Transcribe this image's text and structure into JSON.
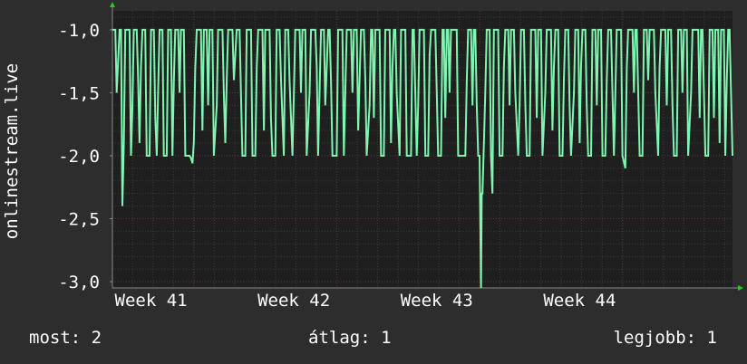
{
  "colors": {
    "background": "#2d2d2d",
    "plot_background": "#1f1f1f",
    "line": "#7ff5b0",
    "grid_minor": "#3a3a3a",
    "grid_major": "#5a3434",
    "axis": "#888888",
    "arrow": "#22cc22",
    "text": "#ffffff"
  },
  "footer": {
    "now": "most: 2",
    "avg": "átlag: 1",
    "best": "legjobb: 1"
  },
  "chart_data": {
    "type": "line",
    "ylabel": "onlinestream.live",
    "y_tick_labels": [
      "-1,0",
      "-1,5",
      "-2,0",
      "-2,5",
      "-3,0"
    ],
    "y_ticks": [
      -1.0,
      -1.5,
      -2.0,
      -2.5,
      -3.0
    ],
    "ylim": [
      -3.05,
      -0.85
    ],
    "x_tick_labels": [
      "Week 41",
      "Week 42",
      "Week 43",
      "Week 44"
    ],
    "x_ticks": [
      40.7,
      41.7,
      42.7,
      43.7
    ],
    "xlim": [
      40.43,
      44.77
    ],
    "grid": true,
    "series": [
      {
        "values": [
          [
            40.43,
            -1.0
          ],
          [
            40.45,
            -1.0
          ],
          [
            40.46,
            -1.5
          ],
          [
            40.48,
            -1.0
          ],
          [
            40.49,
            -1.0
          ],
          [
            40.5,
            -2.4
          ],
          [
            40.51,
            -1.9
          ],
          [
            40.52,
            -1.0
          ],
          [
            40.55,
            -1.0
          ],
          [
            40.56,
            -2.0
          ],
          [
            40.57,
            -1.6
          ],
          [
            40.58,
            -1.0
          ],
          [
            40.6,
            -1.0
          ],
          [
            40.61,
            -1.4
          ],
          [
            40.62,
            -1.9
          ],
          [
            40.63,
            -1.3
          ],
          [
            40.64,
            -1.0
          ],
          [
            40.66,
            -1.0
          ],
          [
            40.67,
            -2.0
          ],
          [
            40.69,
            -2.0
          ],
          [
            40.7,
            -1.0
          ],
          [
            40.72,
            -1.0
          ],
          [
            40.73,
            -1.7
          ],
          [
            40.74,
            -2.0
          ],
          [
            40.75,
            -1.5
          ],
          [
            40.76,
            -1.0
          ],
          [
            40.78,
            -1.0
          ],
          [
            40.79,
            -2.0
          ],
          [
            40.81,
            -2.0
          ],
          [
            40.82,
            -1.0
          ],
          [
            40.84,
            -1.0
          ],
          [
            40.85,
            -2.0
          ],
          [
            40.86,
            -1.4
          ],
          [
            40.87,
            -1.0
          ],
          [
            40.89,
            -1.0
          ],
          [
            40.9,
            -1.5
          ],
          [
            40.91,
            -1.0
          ],
          [
            40.93,
            -1.0
          ],
          [
            40.94,
            -2.0
          ],
          [
            40.97,
            -2.0
          ],
          [
            40.98,
            -2.02
          ],
          [
            40.99,
            -2.06
          ],
          [
            41.0,
            -1.9
          ],
          [
            41.01,
            -1.3
          ],
          [
            41.02,
            -1.0
          ],
          [
            41.05,
            -1.0
          ],
          [
            41.06,
            -1.8
          ],
          [
            41.07,
            -1.0
          ],
          [
            41.09,
            -1.0
          ],
          [
            41.1,
            -1.6
          ],
          [
            41.11,
            -1.0
          ],
          [
            41.13,
            -1.0
          ],
          [
            41.14,
            -2.0
          ],
          [
            41.16,
            -1.6
          ],
          [
            41.17,
            -1.0
          ],
          [
            41.2,
            -1.0
          ],
          [
            41.21,
            -1.5
          ],
          [
            41.22,
            -1.9
          ],
          [
            41.23,
            -1.4
          ],
          [
            41.24,
            -1.0
          ],
          [
            41.27,
            -1.0
          ],
          [
            41.28,
            -1.4
          ],
          [
            41.3,
            -1.0
          ],
          [
            41.32,
            -1.0
          ],
          [
            41.33,
            -1.5
          ],
          [
            41.34,
            -2.0
          ],
          [
            41.36,
            -2.0
          ],
          [
            41.37,
            -1.0
          ],
          [
            41.4,
            -1.0
          ],
          [
            41.41,
            -2.0
          ],
          [
            41.43,
            -2.0
          ],
          [
            41.44,
            -1.3
          ],
          [
            41.45,
            -1.0
          ],
          [
            41.48,
            -1.0
          ],
          [
            41.49,
            -1.8
          ],
          [
            41.5,
            -1.0
          ],
          [
            41.53,
            -1.0
          ],
          [
            41.54,
            -1.7
          ],
          [
            41.55,
            -2.0
          ],
          [
            41.57,
            -2.0
          ],
          [
            41.58,
            -1.0
          ],
          [
            41.6,
            -1.0
          ],
          [
            41.61,
            -1.4
          ],
          [
            41.63,
            -2.0
          ],
          [
            41.64,
            -1.0
          ],
          [
            41.66,
            -1.0
          ],
          [
            41.67,
            -1.4
          ],
          [
            41.69,
            -2.0
          ],
          [
            41.7,
            -1.5
          ],
          [
            41.71,
            -1.0
          ],
          [
            41.74,
            -1.0
          ],
          [
            41.75,
            -1.5
          ],
          [
            41.76,
            -1.0
          ],
          [
            41.78,
            -1.0
          ],
          [
            41.79,
            -2.0
          ],
          [
            41.81,
            -1.5
          ],
          [
            41.82,
            -1.0
          ],
          [
            41.85,
            -1.0
          ],
          [
            41.86,
            -1.3
          ],
          [
            41.87,
            -2.0
          ],
          [
            41.88,
            -1.5
          ],
          [
            41.89,
            -1.0
          ],
          [
            41.91,
            -1.0
          ],
          [
            41.92,
            -1.6
          ],
          [
            41.94,
            -1.0
          ],
          [
            41.95,
            -1.0
          ],
          [
            41.96,
            -1.4
          ],
          [
            41.97,
            -2.0
          ],
          [
            42.0,
            -2.0
          ],
          [
            42.01,
            -1.0
          ],
          [
            42.04,
            -1.0
          ],
          [
            42.05,
            -2.0
          ],
          [
            42.06,
            -1.5
          ],
          [
            42.07,
            -1.0
          ],
          [
            42.1,
            -1.0
          ],
          [
            42.11,
            -1.5
          ],
          [
            42.12,
            -1.0
          ],
          [
            42.14,
            -1.0
          ],
          [
            42.15,
            -1.8
          ],
          [
            42.17,
            -1.0
          ],
          [
            42.19,
            -1.0
          ],
          [
            42.2,
            -1.4
          ],
          [
            42.21,
            -2.0
          ],
          [
            42.23,
            -1.6
          ],
          [
            42.24,
            -1.0
          ],
          [
            42.25,
            -1.0
          ],
          [
            42.26,
            -1.7
          ],
          [
            42.27,
            -1.0
          ],
          [
            42.3,
            -1.0
          ],
          [
            42.31,
            -2.0
          ],
          [
            42.33,
            -2.0
          ],
          [
            42.34,
            -1.0
          ],
          [
            42.37,
            -1.0
          ],
          [
            42.38,
            -1.9
          ],
          [
            42.39,
            -1.3
          ],
          [
            42.4,
            -1.0
          ],
          [
            42.41,
            -1.0
          ],
          [
            42.42,
            -1.5
          ],
          [
            42.44,
            -2.0
          ],
          [
            42.45,
            -1.0
          ],
          [
            42.48,
            -1.0
          ],
          [
            42.49,
            -2.0
          ],
          [
            42.52,
            -2.0
          ],
          [
            42.53,
            -1.0
          ],
          [
            42.54,
            -1.0
          ],
          [
            42.55,
            -1.5
          ],
          [
            42.56,
            -2.0
          ],
          [
            42.57,
            -1.6
          ],
          [
            42.58,
            -1.0
          ],
          [
            42.61,
            -1.0
          ],
          [
            42.62,
            -2.0
          ],
          [
            42.64,
            -2.0
          ],
          [
            42.65,
            -1.2
          ],
          [
            42.66,
            -1.0
          ],
          [
            42.69,
            -1.0
          ],
          [
            42.7,
            -1.5
          ],
          [
            42.71,
            -2.0
          ],
          [
            42.73,
            -2.0
          ],
          [
            42.74,
            -1.0
          ],
          [
            42.75,
            -1.0
          ],
          [
            42.76,
            -1.7
          ],
          [
            42.77,
            -1.0
          ],
          [
            42.78,
            -1.0
          ],
          [
            42.79,
            -1.5
          ],
          [
            42.8,
            -1.0
          ],
          [
            42.84,
            -1.0
          ],
          [
            42.85,
            -2.0
          ],
          [
            42.9,
            -2.0
          ],
          [
            42.91,
            -1.4
          ],
          [
            42.92,
            -1.0
          ],
          [
            42.94,
            -1.0
          ],
          [
            42.95,
            -1.6
          ],
          [
            42.96,
            -1.0
          ],
          [
            42.97,
            -1.0
          ],
          [
            42.98,
            -1.6
          ],
          [
            42.99,
            -2.0
          ],
          [
            43.0,
            -2.0
          ],
          [
            43.01,
            -3.05
          ],
          [
            43.015,
            -2.3
          ],
          [
            43.02,
            -2.3
          ],
          [
            43.03,
            -1.9
          ],
          [
            43.04,
            -1.5
          ],
          [
            43.05,
            -1.0
          ],
          [
            43.07,
            -1.0
          ],
          [
            43.08,
            -2.0
          ],
          [
            43.09,
            -2.3
          ],
          [
            43.1,
            -1.0
          ],
          [
            43.13,
            -1.0
          ],
          [
            43.14,
            -2.0
          ],
          [
            43.16,
            -2.0
          ],
          [
            43.17,
            -1.3
          ],
          [
            43.18,
            -1.0
          ],
          [
            43.2,
            -1.0
          ],
          [
            43.21,
            -1.6
          ],
          [
            43.22,
            -1.0
          ],
          [
            43.24,
            -1.0
          ],
          [
            43.25,
            -1.5
          ],
          [
            43.27,
            -2.0
          ],
          [
            43.28,
            -1.6
          ],
          [
            43.29,
            -1.0
          ],
          [
            43.31,
            -1.0
          ],
          [
            43.32,
            -1.6
          ],
          [
            43.33,
            -2.0
          ],
          [
            43.35,
            -2.0
          ],
          [
            43.36,
            -1.0
          ],
          [
            43.39,
            -1.0
          ],
          [
            43.4,
            -1.7
          ],
          [
            43.41,
            -1.0
          ],
          [
            43.43,
            -1.0
          ],
          [
            43.44,
            -2.0
          ],
          [
            43.46,
            -1.5
          ],
          [
            43.47,
            -1.0
          ],
          [
            43.5,
            -1.0
          ],
          [
            43.51,
            -1.8
          ],
          [
            43.52,
            -1.3
          ],
          [
            43.53,
            -1.0
          ],
          [
            43.55,
            -1.0
          ],
          [
            43.56,
            -2.0
          ],
          [
            43.58,
            -2.0
          ],
          [
            43.59,
            -1.4
          ],
          [
            43.6,
            -1.0
          ],
          [
            43.62,
            -1.0
          ],
          [
            43.63,
            -1.6
          ],
          [
            43.64,
            -2.0
          ],
          [
            43.66,
            -1.5
          ],
          [
            43.67,
            -1.0
          ],
          [
            43.69,
            -1.0
          ],
          [
            43.7,
            -1.9
          ],
          [
            43.71,
            -1.3
          ],
          [
            43.72,
            -1.0
          ],
          [
            43.74,
            -1.0
          ],
          [
            43.75,
            -1.6
          ],
          [
            43.76,
            -2.0
          ],
          [
            43.78,
            -2.0
          ],
          [
            43.79,
            -1.0
          ],
          [
            43.81,
            -1.0
          ],
          [
            43.82,
            -1.6
          ],
          [
            43.83,
            -1.0
          ],
          [
            43.85,
            -1.0
          ],
          [
            43.86,
            -2.0
          ],
          [
            43.88,
            -2.0
          ],
          [
            43.89,
            -1.4
          ],
          [
            43.9,
            -1.0
          ],
          [
            43.92,
            -1.0
          ],
          [
            43.93,
            -1.5
          ],
          [
            43.94,
            -2.0
          ],
          [
            43.95,
            -1.5
          ],
          [
            43.96,
            -1.0
          ],
          [
            43.99,
            -1.0
          ],
          [
            44.0,
            -2.0
          ],
          [
            44.02,
            -2.1
          ],
          [
            44.03,
            -1.3
          ],
          [
            44.04,
            -1.0
          ],
          [
            44.07,
            -1.0
          ],
          [
            44.08,
            -1.5
          ],
          [
            44.09,
            -1.0
          ],
          [
            44.1,
            -1.0
          ],
          [
            44.11,
            -1.5
          ],
          [
            44.12,
            -2.0
          ],
          [
            44.14,
            -2.0
          ],
          [
            44.15,
            -1.0
          ],
          [
            44.17,
            -1.0
          ],
          [
            44.18,
            -1.4
          ],
          [
            44.19,
            -1.0
          ],
          [
            44.22,
            -1.0
          ],
          [
            44.23,
            -1.5
          ],
          [
            44.25,
            -2.0
          ],
          [
            44.26,
            -1.3
          ],
          [
            44.27,
            -1.0
          ],
          [
            44.3,
            -1.0
          ],
          [
            44.31,
            -1.6
          ],
          [
            44.32,
            -1.0
          ],
          [
            44.34,
            -1.0
          ],
          [
            44.35,
            -1.6
          ],
          [
            44.36,
            -2.0
          ],
          [
            44.38,
            -2.0
          ],
          [
            44.39,
            -1.0
          ],
          [
            44.41,
            -1.0
          ],
          [
            44.42,
            -1.5
          ],
          [
            44.43,
            -1.0
          ],
          [
            44.45,
            -1.0
          ],
          [
            44.46,
            -2.0
          ],
          [
            44.48,
            -1.5
          ],
          [
            44.49,
            -1.0
          ],
          [
            44.53,
            -1.0
          ],
          [
            44.54,
            -1.7
          ],
          [
            44.55,
            -1.0
          ],
          [
            44.56,
            -1.0
          ],
          [
            44.57,
            -1.5
          ],
          [
            44.58,
            -2.0
          ],
          [
            44.6,
            -2.0
          ],
          [
            44.61,
            -1.0
          ],
          [
            44.63,
            -1.0
          ],
          [
            44.64,
            -1.7
          ],
          [
            44.65,
            -1.0
          ],
          [
            44.67,
            -1.0
          ],
          [
            44.68,
            -1.9
          ],
          [
            44.69,
            -1.0
          ],
          [
            44.71,
            -1.0
          ],
          [
            44.72,
            -2.0
          ],
          [
            44.73,
            -1.4
          ],
          [
            44.74,
            -1.0
          ],
          [
            44.75,
            -1.0
          ],
          [
            44.76,
            -1.5
          ],
          [
            44.77,
            -2.0
          ]
        ]
      }
    ]
  }
}
